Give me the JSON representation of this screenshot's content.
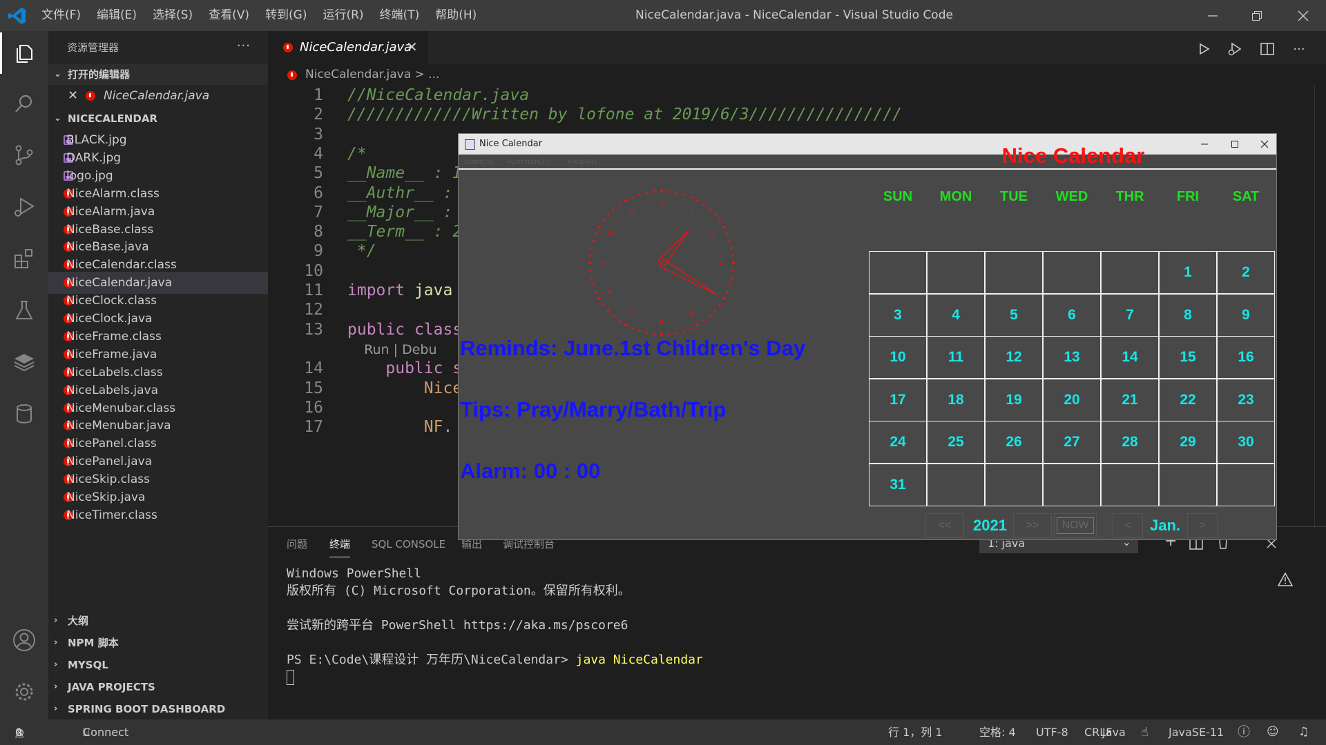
{
  "titlebar": {
    "menus": [
      "文件(F)",
      "编辑(E)",
      "选择(S)",
      "查看(V)",
      "转到(G)",
      "运行(R)",
      "终端(T)",
      "帮助(H)"
    ],
    "title": "NiceCalendar.java - NiceCalendar - Visual Studio Code"
  },
  "sidebar": {
    "header": "资源管理器",
    "open_editors_label": "打开的编辑器",
    "open_editor_file": "NiceCalendar.java",
    "project_label": "NICECALENDAR",
    "files": [
      {
        "name": "BLACK.jpg",
        "icon": "image-file-icon"
      },
      {
        "name": "DARK.jpg",
        "icon": "image-file-icon"
      },
      {
        "name": "logo.jpg",
        "icon": "image-file-icon"
      },
      {
        "name": "NiceAlarm.class",
        "icon": "java-file-icon"
      },
      {
        "name": "NiceAlarm.java",
        "icon": "java-file-icon"
      },
      {
        "name": "NiceBase.class",
        "icon": "java-file-icon"
      },
      {
        "name": "NiceBase.java",
        "icon": "java-file-icon"
      },
      {
        "name": "NiceCalendar.class",
        "icon": "java-file-icon"
      },
      {
        "name": "NiceCalendar.java",
        "icon": "java-file-icon"
      },
      {
        "name": "NiceClock.class",
        "icon": "java-file-icon"
      },
      {
        "name": "NiceClock.java",
        "icon": "java-file-icon"
      },
      {
        "name": "NiceFrame.class",
        "icon": "java-file-icon"
      },
      {
        "name": "NiceFrame.java",
        "icon": "java-file-icon"
      },
      {
        "name": "NiceLabels.class",
        "icon": "java-file-icon"
      },
      {
        "name": "NiceLabels.java",
        "icon": "java-file-icon"
      },
      {
        "name": "NiceMenubar.class",
        "icon": "java-file-icon"
      },
      {
        "name": "NiceMenubar.java",
        "icon": "java-file-icon"
      },
      {
        "name": "NicePanel.class",
        "icon": "java-file-icon"
      },
      {
        "name": "NicePanel.java",
        "icon": "java-file-icon"
      },
      {
        "name": "NiceSkip.class",
        "icon": "java-file-icon"
      },
      {
        "name": "NiceSkip.java",
        "icon": "java-file-icon"
      },
      {
        "name": "NiceTimer.class",
        "icon": "java-file-icon"
      }
    ],
    "selected_file": "NiceCalendar.java",
    "sections": [
      "大纲",
      "NPM 脚本",
      "MYSQL",
      "JAVA PROJECTS",
      "SPRING BOOT DASHBOARD"
    ]
  },
  "editor": {
    "tab_label": "NiceCalendar.java",
    "breadcrumb": "NiceCalendar.java > ...",
    "lines": [
      {
        "n": "1",
        "parts": [
          [
            "cmt",
            "//NiceCalendar.java"
          ]
        ]
      },
      {
        "n": "2",
        "parts": [
          [
            "cmt",
            "/////////////Written by lofone at 2019/6/3////////////////"
          ]
        ]
      },
      {
        "n": "3",
        "parts": []
      },
      {
        "n": "4",
        "parts": [
          [
            "cmt",
            "/*"
          ]
        ]
      },
      {
        "n": "5",
        "parts": [
          [
            "cmt",
            "__Name__ : I"
          ]
        ]
      },
      {
        "n": "6",
        "parts": [
          [
            "cmt",
            "__Authr__ :"
          ]
        ]
      },
      {
        "n": "7",
        "parts": [
          [
            "cmt",
            "__Major__ :"
          ]
        ]
      },
      {
        "n": "8",
        "parts": [
          [
            "cmt",
            "__Term__ : 2"
          ]
        ]
      },
      {
        "n": "9",
        "parts": [
          [
            "cmt",
            " */"
          ]
        ]
      },
      {
        "n": "10",
        "parts": []
      },
      {
        "n": "11",
        "parts": [
          [
            "kw",
            "import "
          ],
          [
            "tp",
            "java"
          ]
        ]
      },
      {
        "n": "12",
        "parts": []
      },
      {
        "n": "13",
        "parts": [
          [
            "kw",
            "public "
          ],
          [
            "kw",
            "class"
          ]
        ]
      },
      {
        "n": "",
        "parts": [
          [
            "ann",
            "    Run | Debu"
          ]
        ]
      },
      {
        "n": "14",
        "parts": [
          [
            "kw",
            "    public "
          ],
          [
            "kw",
            "s"
          ]
        ]
      },
      {
        "n": "15",
        "parts": [
          [
            "id",
            "        Nice"
          ]
        ]
      },
      {
        "n": "16",
        "parts": []
      },
      {
        "n": "17",
        "parts": [
          [
            "id",
            "        NF."
          ]
        ]
      }
    ]
  },
  "panel": {
    "tabs": [
      "问题",
      "终端",
      "SQL CONSOLE",
      "输出",
      "调试控制台"
    ],
    "active_tab": "终端",
    "terminal_select": "1: java",
    "terminal_lines": [
      "Windows PowerShell",
      "版权所有 (C) Microsoft Corporation。保留所有权利。",
      "",
      "尝试新的跨平台 PowerShell https://aka.ms/pscore6",
      ""
    ],
    "prompt": "PS E:\\Code\\课程设计 万年历\\NiceCalendar> ",
    "command": "java NiceCalendar"
  },
  "statusbar": {
    "errors": "0",
    "warnings": "0",
    "connect": "Connect",
    "position": "行 1，列 1",
    "spaces": "空格: 4",
    "encoding": "UTF-8",
    "eol": "CRLF",
    "language": "Java",
    "runtime": "JavaSE-11"
  },
  "nice_calendar": {
    "window_title": "Nice Calendar",
    "menu": [
      "Start(S)",
      "Function(F)",
      "Help(H)"
    ],
    "title": "Nice Calendar",
    "weekdays": [
      "SUN",
      "MON",
      "TUE",
      "WED",
      "THR",
      "FRI",
      "SAT"
    ],
    "days": [
      [
        "",
        "",
        "",
        "",
        "",
        "1",
        "2"
      ],
      [
        "3",
        "4",
        "5",
        "6",
        "7",
        "8",
        "9"
      ],
      [
        "10",
        "11",
        "12",
        "13",
        "14",
        "15",
        "16"
      ],
      [
        "17",
        "18",
        "19",
        "20",
        "21",
        "22",
        "23"
      ],
      [
        "24",
        "25",
        "26",
        "27",
        "28",
        "29",
        "30"
      ],
      [
        "31",
        "",
        "",
        "",
        "",
        "",
        ""
      ]
    ],
    "reminds": "Reminds: June.1st Children's Day",
    "tips": "Tips: Pray/Marry/Bath/Trip",
    "alarm": "Alarm: 00 : 00",
    "year": "2021",
    "month": "Jan.",
    "nav": {
      "prev_year": "<<",
      "next_year": ">>",
      "now": "NOW",
      "prev_month": "<",
      "next_month": ">"
    },
    "clock": {
      "hour_hand_deg": 40,
      "minute_hand_deg": 120
    },
    "colors": {
      "title": "#ff1010",
      "weekday": "#22dd22",
      "day": "#17e6e6",
      "info": "#1414ff",
      "clock": "#e01818"
    }
  }
}
